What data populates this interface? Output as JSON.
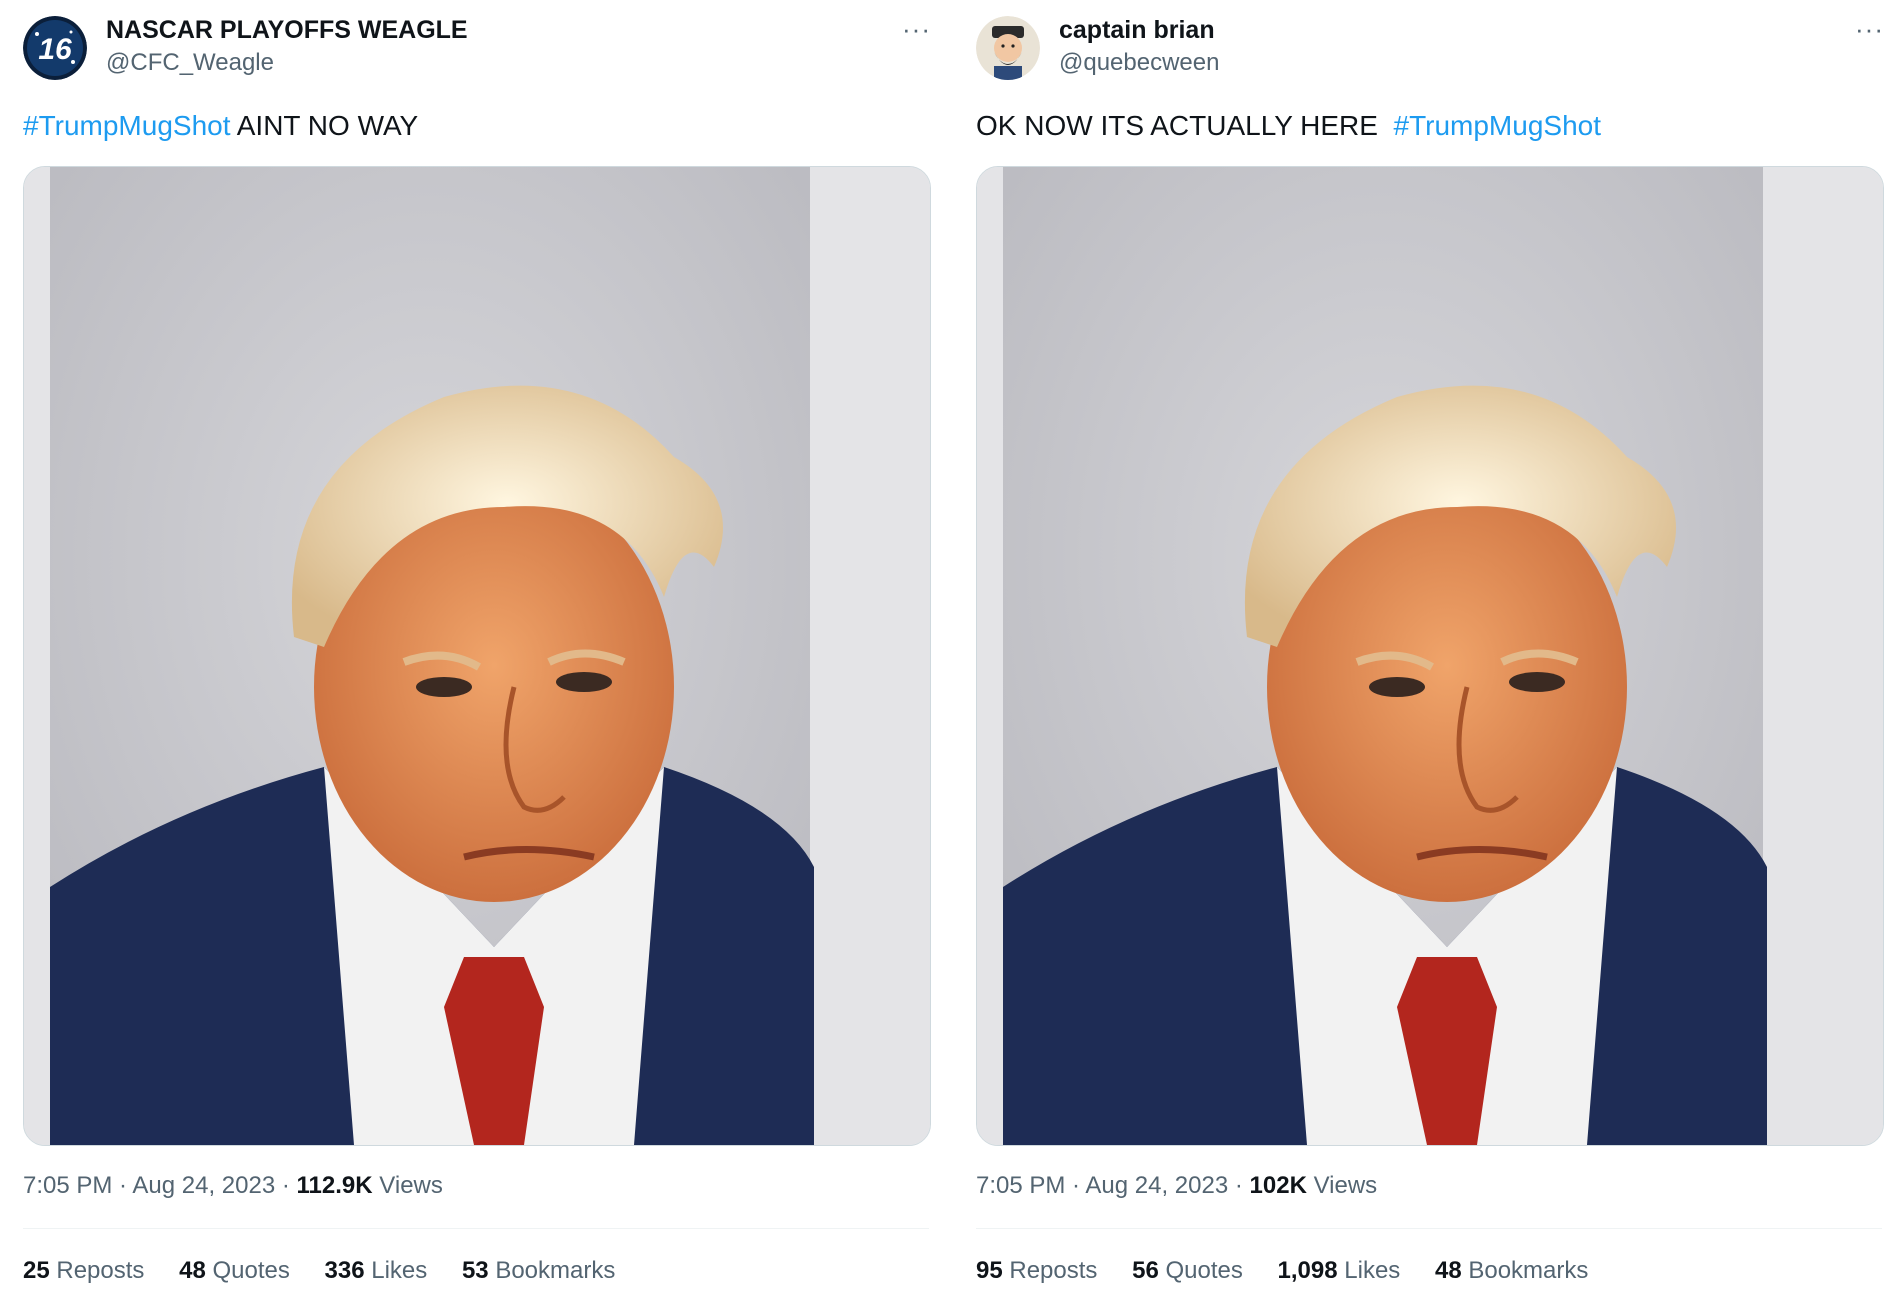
{
  "tweets": [
    {
      "display_name": "NASCAR PLAYOFFS WEAGLE",
      "handle": "@CFC_Weagle",
      "avatar_icon": "nascar-16-icon",
      "avatar_text": "16",
      "more_label": "···",
      "text_hashtag": "#TrumpMugShot",
      "text_body": " AINT NO WAY",
      "time": "7:05 PM",
      "date": "Aug 24, 2023",
      "views_count": "112.9K",
      "views_label": "Views",
      "stats": {
        "reposts": {
          "count": "25",
          "label": "Reposts"
        },
        "quotes": {
          "count": "48",
          "label": "Quotes"
        },
        "likes": {
          "count": "336",
          "label": "Likes"
        },
        "bookmarks": {
          "count": "53",
          "label": "Bookmarks"
        }
      }
    },
    {
      "display_name": "captain brian",
      "handle": "@quebecween",
      "avatar_icon": "captain-cartoon-icon",
      "more_label": "···",
      "text_body": "OK NOW ITS ACTUALLY HERE  ",
      "text_hashtag": "#TrumpMugShot",
      "time": "7:05 PM",
      "date": "Aug 24, 2023",
      "views_count": "102K",
      "views_label": "Views",
      "stats": {
        "reposts": {
          "count": "95",
          "label": "Reposts"
        },
        "quotes": {
          "count": "56",
          "label": "Quotes"
        },
        "likes": {
          "count": "1,098",
          "label": "Likes"
        },
        "bookmarks": {
          "count": "48",
          "label": "Bookmarks"
        }
      }
    }
  ],
  "colors": {
    "hashtag": "#1d9bf0",
    "secondary_text": "#536471",
    "primary_text": "#0f1419"
  }
}
